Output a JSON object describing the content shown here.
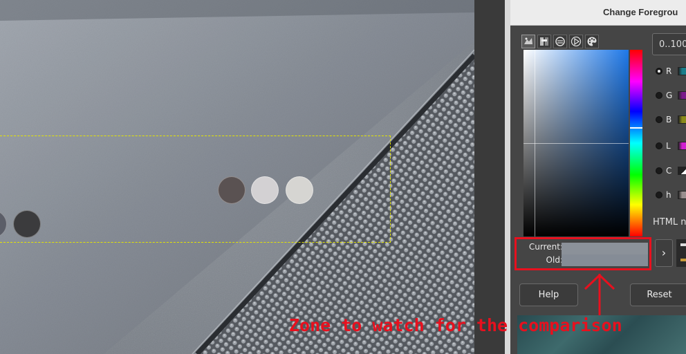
{
  "canvas": {
    "dots": [
      {
        "color": "#5a5252"
      },
      {
        "color": "#d3d1d3"
      },
      {
        "color": "#d6d5d2"
      },
      {
        "color": "#5b5e68"
      },
      {
        "color": "#3b3b3d"
      }
    ],
    "selection_color": "#e6e600"
  },
  "dialog": {
    "title": "Change Foregrou",
    "selector_tabs": [
      {
        "icon": "gimp-selector-icon"
      },
      {
        "icon": "cmyk-selector-icon"
      },
      {
        "icon": "watercolor-selector-icon"
      },
      {
        "icon": "triangle-selector-icon"
      },
      {
        "icon": "palette-selector-icon"
      }
    ],
    "scale_value": "0..100",
    "channels": [
      {
        "label": "R",
        "checked": true,
        "bar_color": "#1a7d8a"
      },
      {
        "label": "G",
        "checked": false,
        "bar_color": "#7a1a8a"
      },
      {
        "label": "B",
        "checked": false,
        "bar_color": "#8a8a1a"
      },
      {
        "label": "L",
        "checked": false,
        "bar_color": "#d020d0"
      },
      {
        "label": "C",
        "checked": false,
        "bar_color": "#ffffff"
      },
      {
        "label": "h",
        "checked": false,
        "bar_color": "#9a8f8f"
      }
    ],
    "html_label": "HTML n",
    "current_label": "Current:",
    "old_label": "Old:",
    "current_color": "#8b9199",
    "old_color": "#858c96",
    "arrow_glyph": "›",
    "help_label": "Help",
    "reset_label": "Reset"
  },
  "annotation": {
    "text": "Zone to watch for the comparison",
    "color": "#e8101e"
  }
}
